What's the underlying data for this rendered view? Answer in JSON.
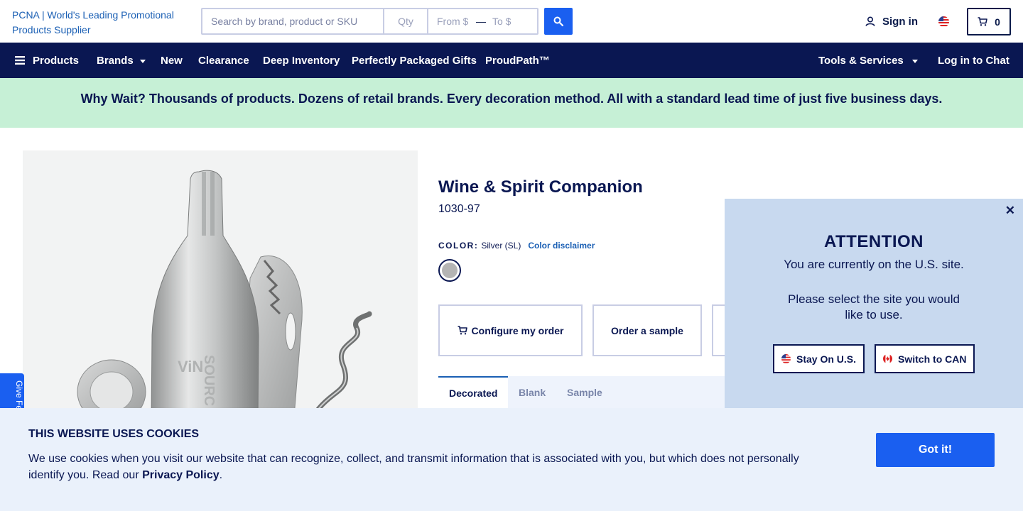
{
  "header": {
    "logo_alt": "PCNA | World's Leading Promotional Products Supplier",
    "search_placeholder": "Search by brand, product or SKU",
    "qty_placeholder": "Qty",
    "price_from_placeholder": "From $",
    "price_separator": "—",
    "price_to_placeholder": "To $",
    "sign_in": "Sign in",
    "cart_count": "0"
  },
  "nav": {
    "products": "Products",
    "brands": "Brands",
    "new": "New",
    "clearance": "Clearance",
    "deep_inventory": "Deep Inventory",
    "perfectly_packaged": "Perfectly Packaged Gifts",
    "proudpath": "ProudPath™",
    "tools_services": "Tools & Services",
    "log_in_chat": "Log in to Chat"
  },
  "banner": {
    "text": "Why Wait? Thousands of products. Dozens of retail brands. Every decoration method. All with a standard lead time of just five business days."
  },
  "product": {
    "title": "Wine & Spirit Companion",
    "sku": "1030-97",
    "color_label": "COLOR:",
    "color_value": "Silver (SL)",
    "color_disclaimer": "Color disclaimer",
    "swatch_color": "#b4b4b4",
    "configure_label": "Configure my order",
    "sample_label": "Order a sample",
    "tabs": [
      "Decorated",
      "Blank",
      "Sample"
    ],
    "image_engraving": "ViNO SOURCE"
  },
  "attention": {
    "heading": "ATTENTION",
    "line1": "You are currently on the U.S. site.",
    "line2": "Please select the site you would like to use.",
    "stay_label": "Stay On U.S.",
    "switch_label": "Switch to CAN",
    "close_label": "✕"
  },
  "feedback": {
    "label": "Give Feedback"
  },
  "cookie": {
    "title": "THIS WEBSITE USES COOKIES",
    "body": "We use cookies when you visit our website that can recognize, collect, and transmit information that is associated with you, but which does not personally identify you. Read our ",
    "policy_link": "Privacy Policy",
    "body_end": ".",
    "button": "Got it!"
  },
  "colors": {
    "navy": "#0a1752",
    "accent_blue": "#1a5ff0",
    "banner_green": "#c6f0d6",
    "attention_bg": "#c8d9ef",
    "cookie_bg": "#eaf1fb"
  }
}
